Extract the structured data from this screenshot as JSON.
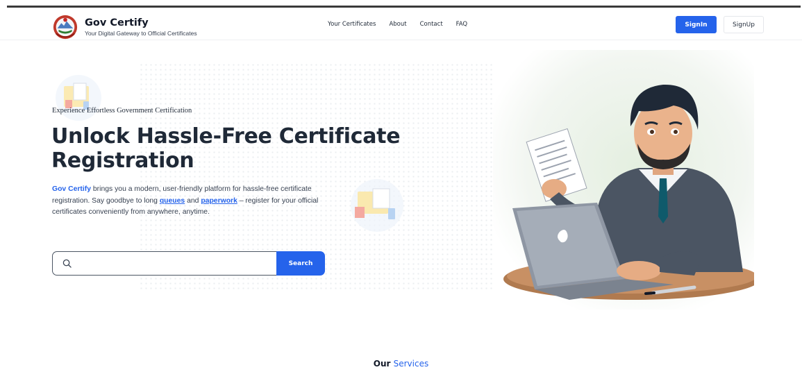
{
  "brand": {
    "name": "Gov Certify",
    "tagline": "Your Digital Gateway to Official Certificates"
  },
  "nav": {
    "items": [
      {
        "label": "Your Certificates"
      },
      {
        "label": "About"
      },
      {
        "label": "Contact"
      },
      {
        "label": "FAQ"
      }
    ]
  },
  "auth": {
    "signin_label": "SignIn",
    "signup_label": "SignUp"
  },
  "hero": {
    "eyebrow": "Experience Effortless Government Certification",
    "headline_line1": "Unlock Hassle-Free Certificate",
    "headline_line2": "Registration",
    "lead_brand": "Gov Certify",
    "lead_part1": " brings you a modern, user-friendly platform for hassle-free certificate registration. Say goodbye to long ",
    "lead_link1": "queues",
    "lead_part2": " and ",
    "lead_link2": "paperwork",
    "lead_part3": " – register for your official certificates conveniently from anywhere, anytime."
  },
  "search": {
    "value": "",
    "placeholder": "",
    "button_label": "Search"
  },
  "services": {
    "word1": "Our",
    "word2": "Services"
  },
  "colors": {
    "primary": "#2563eb",
    "text": "#1f2937"
  },
  "icons": [
    "search-icon",
    "emblem-logo",
    "document-icon"
  ]
}
